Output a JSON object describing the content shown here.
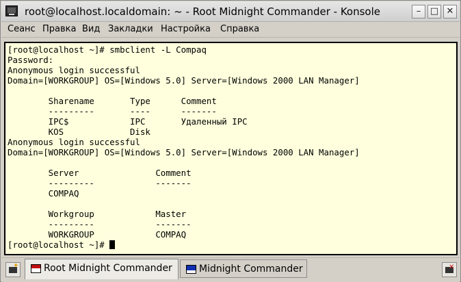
{
  "window": {
    "title": "root@localhost.localdomain: ~ - Root Midnight Commander - Konsole",
    "buttons": {
      "minimize": "–",
      "maximize": "□",
      "close": "✕"
    }
  },
  "menu": [
    "Сеанс",
    "Правка",
    "Вид",
    "Закладки",
    "Настройка",
    "Справка"
  ],
  "terminal": {
    "lines": [
      "[root@localhost ~]# smbclient -L Compaq",
      "Password:",
      "Anonymous login successful",
      "Domain=[WORKGROUP] OS=[Windows 5.0] Server=[Windows 2000 LAN Manager]",
      "",
      "        Sharename       Type      Comment",
      "        ---------       ----      -------",
      "        IPC$            IPC       Удаленный IPC",
      "        KOS             Disk",
      "Anonymous login successful",
      "Domain=[WORKGROUP] OS=[Windows 5.0] Server=[Windows 2000 LAN Manager]",
      "",
      "        Server               Comment",
      "        ---------            -------",
      "        COMPAQ",
      "",
      "        Workgroup            Master",
      "        ---------            -------",
      "        WORKGROUP            COMPAQ",
      "[root@localhost ~]# "
    ]
  },
  "tabs": [
    {
      "label": "Root Midnight Commander",
      "active": true,
      "icon": "root-terminal-icon"
    },
    {
      "label": "Midnight Commander",
      "active": false,
      "icon": "terminal-icon"
    }
  ],
  "colors": {
    "terminal_bg": "#ffffdd",
    "terminal_fg": "#000000",
    "chrome_bg": "#d4d0c8"
  }
}
